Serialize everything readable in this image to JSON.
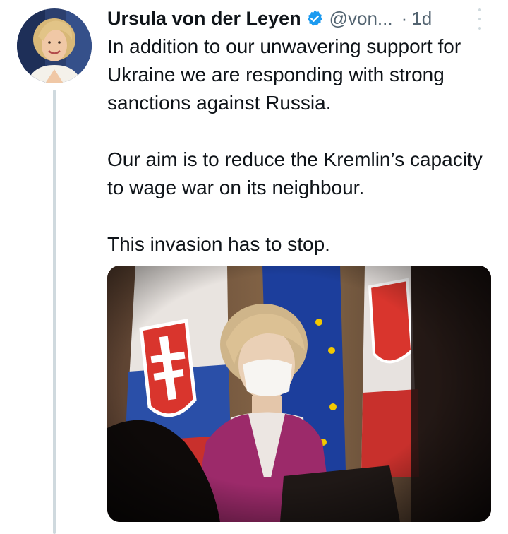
{
  "tweet": {
    "author_name": "Ursula von der Leyen",
    "handle": "@von...",
    "separator": "·",
    "time": "1d",
    "verified_icon": "verified-badge-icon",
    "more_icon": "more-options-icon",
    "paragraphs": [
      "In addition to our unwavering support for Ukraine we are responding with strong sanctions against Russia.",
      "Our aim is to reduce the Kremlin’s capacity to wage war on its neighbour.",
      "This invasion has to stop."
    ],
    "media": {
      "type": "photo"
    }
  },
  "colors": {
    "text": "#0f1419",
    "secondary": "#536471",
    "verified": "#1d9bf0",
    "thread_line": "#cfd9de"
  }
}
